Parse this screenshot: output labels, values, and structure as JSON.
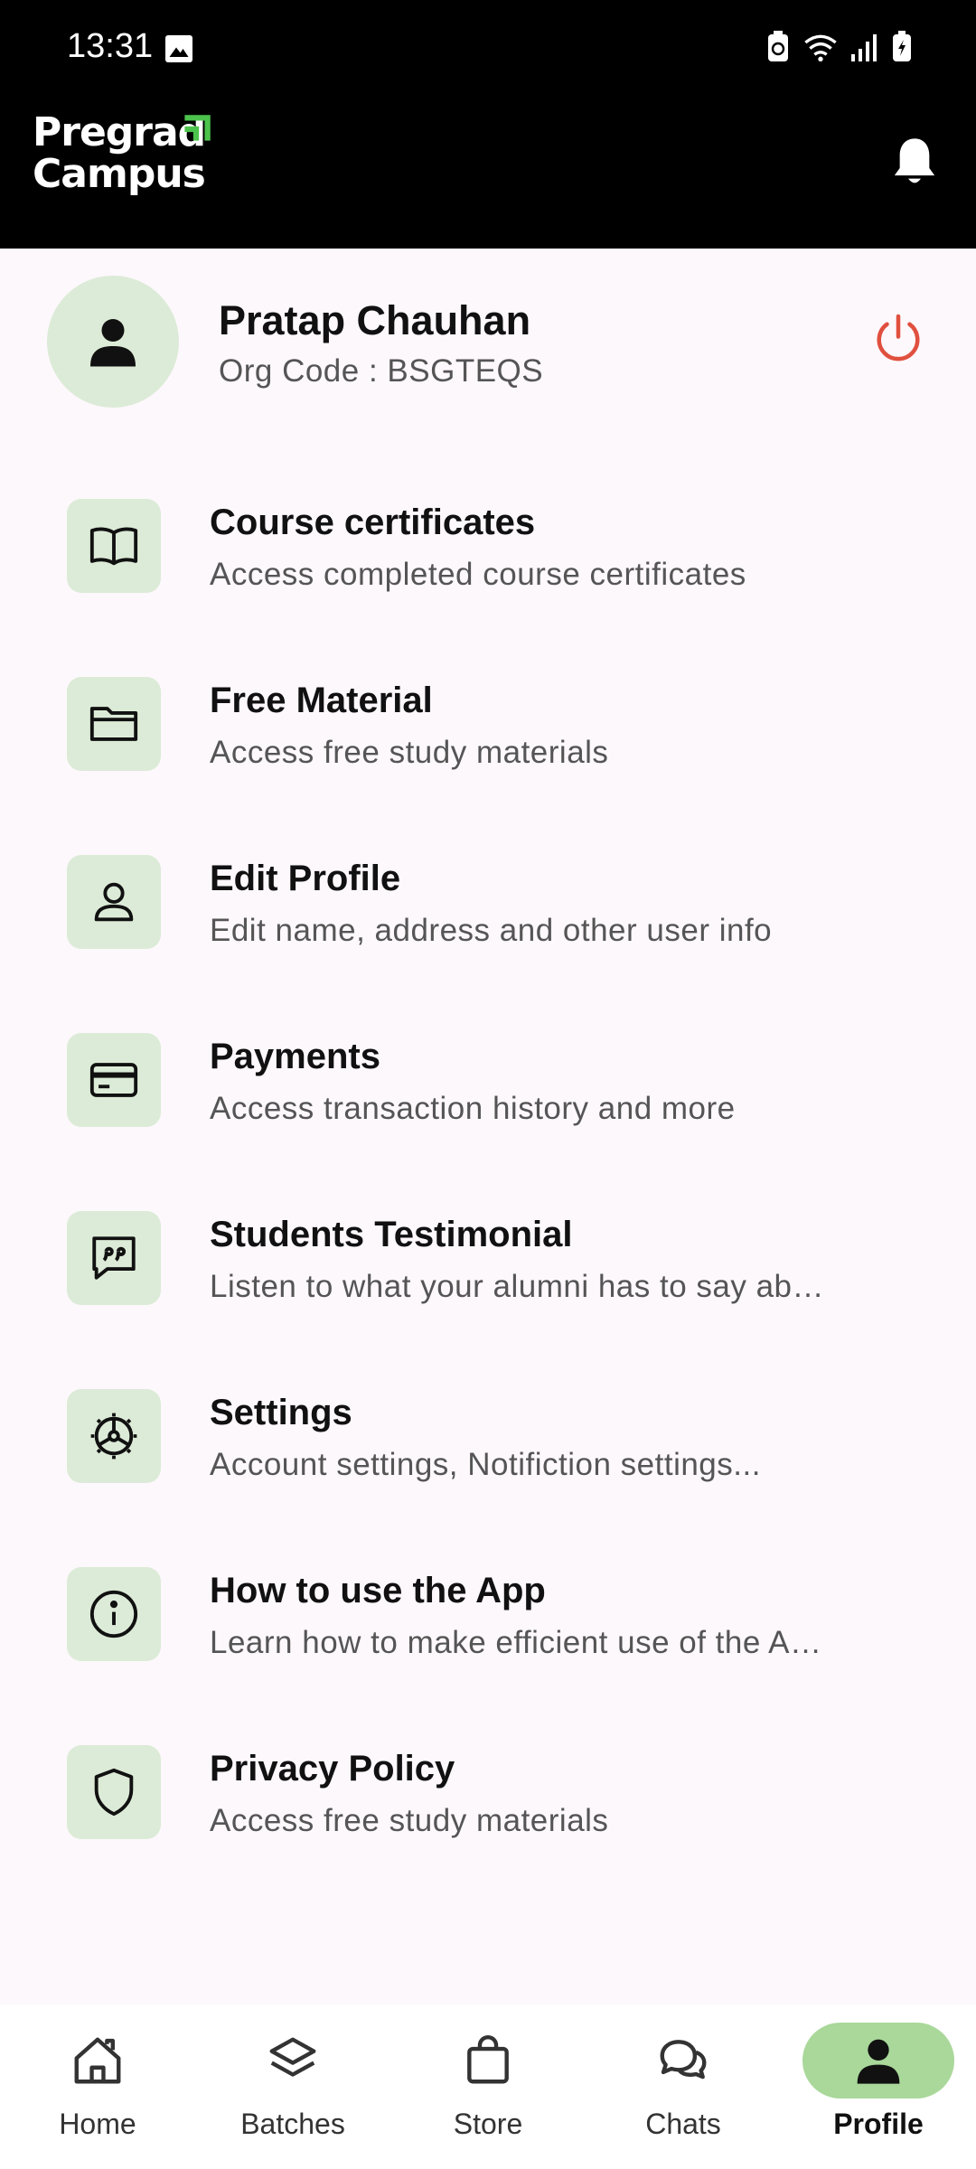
{
  "status_bar": {
    "time": "13:31"
  },
  "header": {
    "logo_line1": "Pregrad",
    "logo_line2": "Campus"
  },
  "profile": {
    "name": "Pratap Chauhan",
    "org_code": "Org Code : BSGTEQS"
  },
  "menu": {
    "items": [
      {
        "title": "Course certificates",
        "subtitle": "Access completed course certificates",
        "icon": "book-icon"
      },
      {
        "title": "Free Material",
        "subtitle": "Access free study materials",
        "icon": "folder-icon"
      },
      {
        "title": "Edit Profile",
        "subtitle": "Edit name, address and other user info",
        "icon": "person-icon"
      },
      {
        "title": "Payments",
        "subtitle": "Access transaction history and more",
        "icon": "card-icon"
      },
      {
        "title": "Students Testimonial",
        "subtitle": "Listen to what your alumni has to say ab…",
        "icon": "quote-chat-icon"
      },
      {
        "title": "Settings",
        "subtitle": "Account settings, Notifiction settings...",
        "icon": "settings-icon"
      },
      {
        "title": "How to use the App",
        "subtitle": "Learn how to make efficient use of the A…",
        "icon": "info-icon"
      },
      {
        "title": "Privacy Policy",
        "subtitle": "Access free study materials",
        "icon": "shield-icon"
      }
    ]
  },
  "bottom_nav": {
    "items": [
      {
        "label": "Home",
        "icon": "home-icon"
      },
      {
        "label": "Batches",
        "icon": "layers-icon"
      },
      {
        "label": "Store",
        "icon": "bag-icon"
      },
      {
        "label": "Chats",
        "icon": "chats-icon"
      },
      {
        "label": "Profile",
        "icon": "profile-icon",
        "active": true
      }
    ]
  },
  "colors": {
    "header_bg": "#000000",
    "page_bg": "#fdf8fc",
    "icon_tile_bg": "#dcebd7",
    "nav_active_pill": "#a9d89a",
    "logout_red": "#e0503f",
    "logo_accent": "#4cc34c"
  }
}
